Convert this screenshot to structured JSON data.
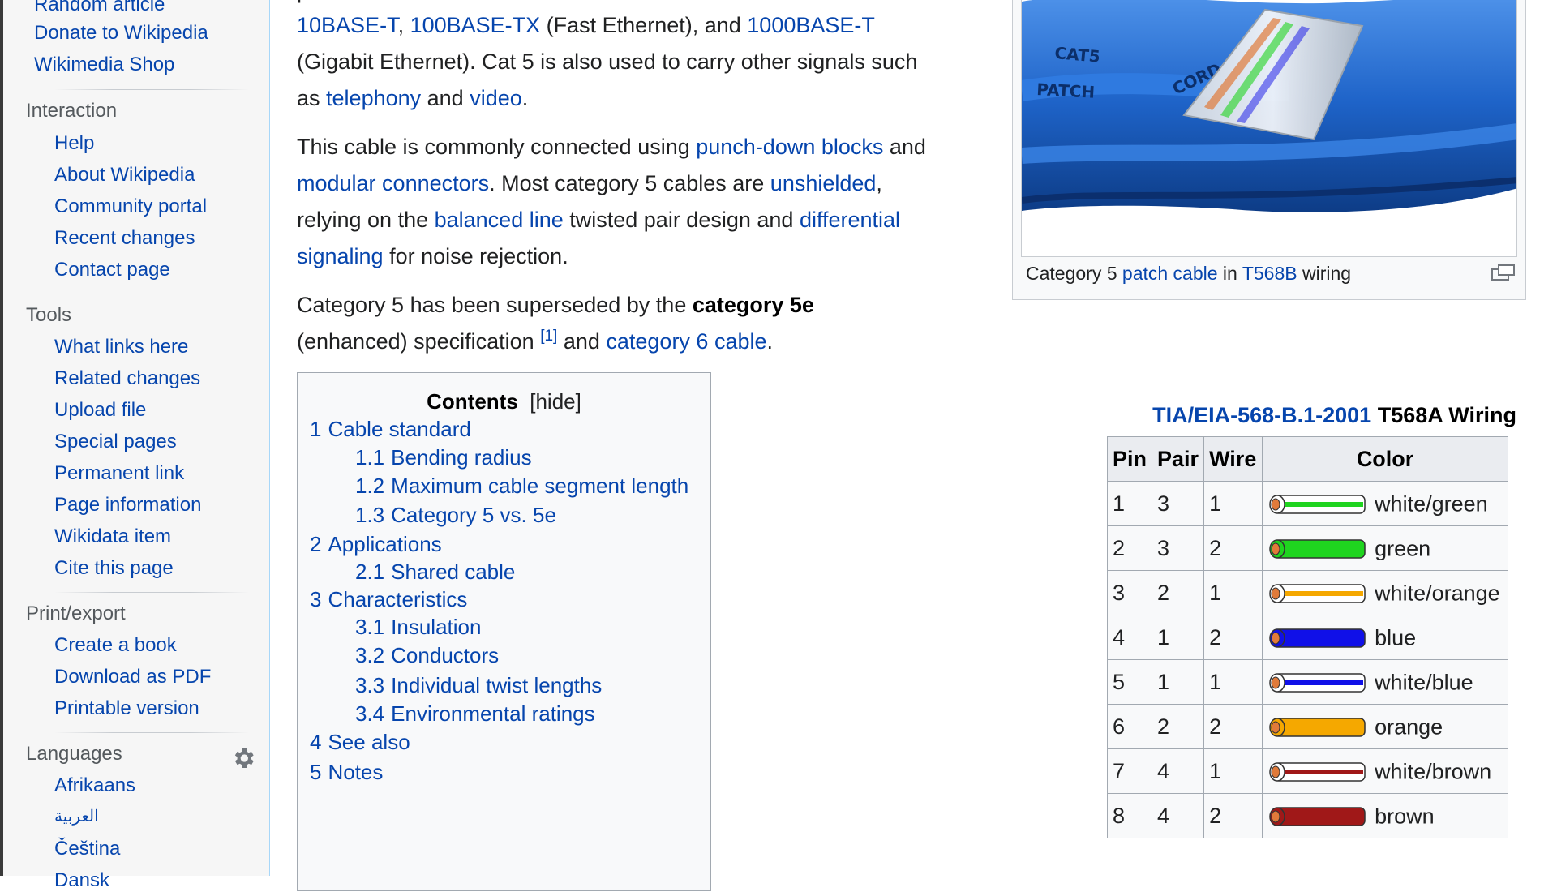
{
  "sidebar": {
    "top_links": [
      "Random article",
      "Donate to Wikipedia",
      "Wikimedia Shop"
    ],
    "interaction": {
      "heading": "Interaction",
      "links": [
        "Help",
        "About Wikipedia",
        "Community portal",
        "Recent changes",
        "Contact page"
      ]
    },
    "tools": {
      "heading": "Tools",
      "links": [
        "What links here",
        "Related changes",
        "Upload file",
        "Special pages",
        "Permanent link",
        "Page information",
        "Wikidata item",
        "Cite this page"
      ]
    },
    "print_export": {
      "heading": "Print/export",
      "links": [
        "Create a book",
        "Download as PDF",
        "Printable version"
      ]
    },
    "languages": {
      "heading": "Languages",
      "settings_icon": "gear-icon",
      "links": [
        "Afrikaans",
        "العربية",
        "Čeština",
        "Dansk"
      ]
    }
  },
  "article": {
    "para1": {
      "top_fragment": "pair for Ethernet that can be used for",
      "line1": [
        {
          "text": "10BASE-T",
          "link": true
        },
        {
          "text": ", ",
          "link": false
        },
        {
          "text": "100BASE-TX",
          "link": true
        },
        {
          "text": " (Fast Ethernet), and ",
          "link": false
        },
        {
          "text": "1000BASE-T",
          "link": true
        }
      ],
      "line2": "(Gigabit Ethernet). Cat 5 is also used to carry other signals such",
      "line3": [
        {
          "text": "as ",
          "link": false
        },
        {
          "text": "telephony",
          "link": true
        },
        {
          "text": " and ",
          "link": false
        },
        {
          "text": "video",
          "link": true
        },
        {
          "text": ".",
          "link": false
        }
      ]
    },
    "para2": {
      "line1": [
        {
          "text": "This cable is commonly connected using ",
          "link": false
        },
        {
          "text": "punch-down blocks",
          "link": true
        },
        {
          "text": " and",
          "link": false
        }
      ],
      "line2": [
        {
          "text": "modular connectors",
          "link": true
        },
        {
          "text": ". Most category 5 cables are ",
          "link": false
        },
        {
          "text": "unshielded",
          "link": true
        },
        {
          "text": ",",
          "link": false
        }
      ],
      "line3": [
        {
          "text": "relying on the ",
          "link": false
        },
        {
          "text": "balanced line",
          "link": true
        },
        {
          "text": " twisted pair design and ",
          "link": false
        },
        {
          "text": "differential",
          "link": true
        }
      ],
      "line4": [
        {
          "text": "signaling",
          "link": true
        },
        {
          "text": " for noise rejection.",
          "link": false
        }
      ]
    },
    "para3": {
      "line1_plain": "Category 5 has been superseded by the ",
      "line1_bold": "category 5e",
      "line2_plain": "(enhanced) specification ",
      "line2_ref": "[1]",
      "line2_mid": " and ",
      "line2_link": "category 6 cable",
      "line2_end": "."
    }
  },
  "toc": {
    "title": "Contents",
    "toggle": "[hide]",
    "items": [
      {
        "num": "1",
        "label": "Cable standard",
        "level": 1
      },
      {
        "num": "1.1",
        "label": "Bending radius",
        "level": 2
      },
      {
        "num": "1.2",
        "label": "Maximum cable segment length",
        "level": 2
      },
      {
        "num": "1.3",
        "label": "Category 5 vs. 5e",
        "level": 2
      },
      {
        "num": "2",
        "label": "Applications",
        "level": 1
      },
      {
        "num": "2.1",
        "label": "Shared cable",
        "level": 2
      },
      {
        "num": "3",
        "label": "Characteristics",
        "level": 1
      },
      {
        "num": "3.1",
        "label": "Insulation",
        "level": 2
      },
      {
        "num": "3.2",
        "label": "Conductors",
        "level": 2
      },
      {
        "num": "3.3",
        "label": "Individual twist lengths",
        "level": 2
      },
      {
        "num": "3.4",
        "label": "Environmental ratings",
        "level": 2
      },
      {
        "num": "4",
        "label": "See also",
        "level": 1
      },
      {
        "num": "5",
        "label": "Notes",
        "level": 1
      }
    ]
  },
  "thumbnail": {
    "cable_print_1": "CAT5",
    "cable_print_2": "PATCH",
    "cable_print_3": "CORD",
    "caption": [
      {
        "text": "Category 5 ",
        "link": false
      },
      {
        "text": "patch cable",
        "link": true
      },
      {
        "text": " in ",
        "link": false
      },
      {
        "text": "T568B",
        "link": true
      },
      {
        "text": " wiring",
        "link": false
      }
    ],
    "magnify_icon": "magnify-icon",
    "cable_color": "#1e63c8"
  },
  "wiring": {
    "caption_link": "TIA/EIA-568-B.1-2001",
    "caption_rest": " T568A Wiring",
    "headers": [
      "Pin",
      "Pair",
      "Wire",
      "Color"
    ],
    "rows": [
      {
        "pin": "1",
        "pair": "3",
        "wire": "1",
        "color": "white/green",
        "base": "#ffffff",
        "stripe": "#1fd41f"
      },
      {
        "pin": "2",
        "pair": "3",
        "wire": "2",
        "color": "green",
        "base": "#1fd41f",
        "stripe": "#1fd41f"
      },
      {
        "pin": "3",
        "pair": "2",
        "wire": "1",
        "color": "white/orange",
        "base": "#ffffff",
        "stripe": "#f5a800"
      },
      {
        "pin": "4",
        "pair": "1",
        "wire": "2",
        "color": "blue",
        "base": "#1010e8",
        "stripe": "#1010e8"
      },
      {
        "pin": "5",
        "pair": "1",
        "wire": "1",
        "color": "white/blue",
        "base": "#ffffff",
        "stripe": "#1010e8"
      },
      {
        "pin": "6",
        "pair": "2",
        "wire": "2",
        "color": "orange",
        "base": "#f5a800",
        "stripe": "#f5a800"
      },
      {
        "pin": "7",
        "pair": "4",
        "wire": "1",
        "color": "white/brown",
        "base": "#ffffff",
        "stripe": "#a01818"
      },
      {
        "pin": "8",
        "pair": "4",
        "wire": "2",
        "color": "brown",
        "base": "#a01818",
        "stripe": "#a01818"
      }
    ],
    "copper_color": "#e07a3a"
  }
}
